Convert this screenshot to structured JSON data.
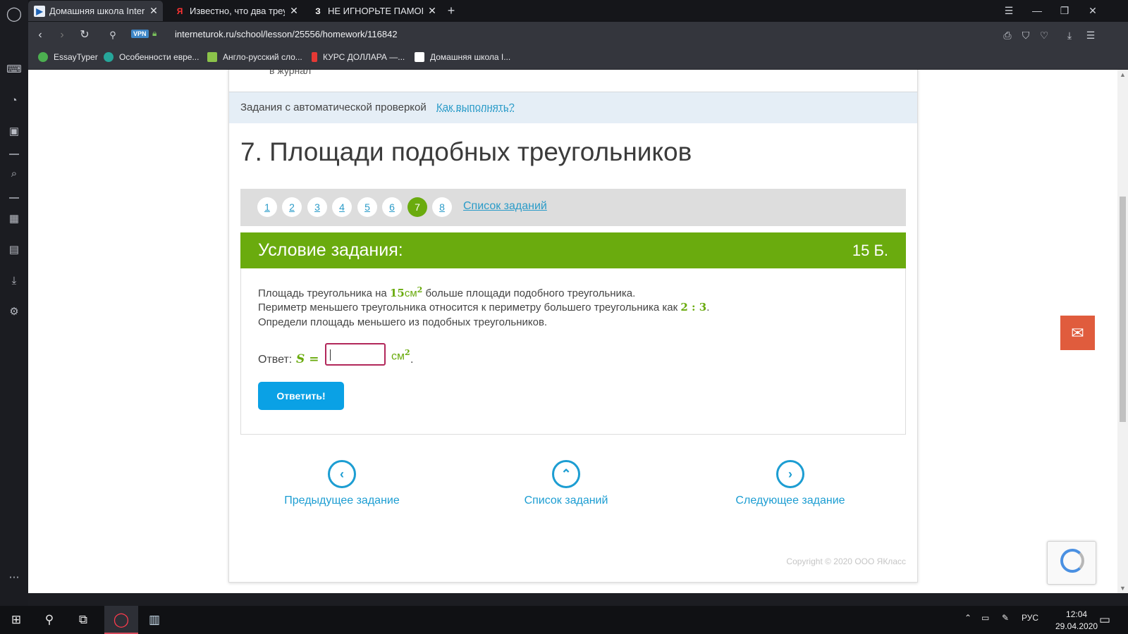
{
  "browser": {
    "tabs": [
      {
        "label": "Домашняя школа Internet",
        "icon": "interneturok-favicon",
        "active": true
      },
      {
        "label": "Известно, что два треугол",
        "icon": "yandex-favicon",
        "active": false
      },
      {
        "label": "НЕ ИГНОРЬТЕ ПАМОГИТЕ",
        "icon": "znanija-favicon",
        "active": false
      }
    ],
    "tab_icon_glyphs": {
      "yandex": "Я",
      "znanija": "З"
    },
    "new_tab_symbol": "+",
    "url": "interneturok.ru/school/lesson/25556/homework/116842",
    "vpn_label": "VPN",
    "bookmarks": [
      {
        "label": "EssayTyper",
        "color": "#4caf50"
      },
      {
        "label": "Особенности евре...",
        "color": "#26a69a"
      },
      {
        "label": "Англо-русский сло...",
        "color": "#8bc34a"
      },
      {
        "label": "КУРС ДОЛЛАРА —...",
        "color": "#e53935"
      },
      {
        "label": "Домашняя школа I...",
        "color": "#ffffff"
      }
    ]
  },
  "page": {
    "journal_text": "в журнал",
    "auto_check_text": "Задания с автоматической проверкой",
    "how_to_link": "Как выполнять?",
    "lesson_title": "7. Площади подобных треугольников",
    "pager": {
      "items": [
        "1",
        "2",
        "3",
        "4",
        "5",
        "6",
        "7",
        "8"
      ],
      "current": "7",
      "list_link": "Список заданий"
    },
    "task": {
      "title": "Условие задания:",
      "points": "15 Б.",
      "line1_prefix": "Площадь треугольника на",
      "line1_value": "15",
      "line1_unit": "см",
      "line1_power": "2",
      "line1_suffix": "больше площади подобного треугольника.",
      "line2_prefix": "Периметр меньшего треугольника относится к периметру большего треугольника как",
      "line2_ratio": "2 : 3",
      "line2_suffix": ".",
      "line3": "Определи площадь меньшего из подобных треугольников.",
      "answer_label": "Ответ:",
      "answer_var": "S =",
      "answer_value": "",
      "answer_unit": "см",
      "answer_power": "2",
      "answer_dot": ".",
      "submit_label": "Ответить!"
    },
    "bottom_nav": [
      {
        "label": "Предыдущее задание",
        "icon": "chevron-left-icon",
        "glyph": "‹"
      },
      {
        "label": "Список заданий",
        "icon": "chevron-up-icon",
        "glyph": "⌃"
      },
      {
        "label": "Следующее задание",
        "icon": "chevron-right-icon",
        "glyph": "›"
      }
    ],
    "copyright": "Copyright © 2020 ООО ЯКласс",
    "colors": {
      "accent_green": "#6aab0e",
      "link_blue": "#2a9bc8",
      "button_blue": "#0aa1e5",
      "chat_orange": "#e05c3d"
    }
  },
  "taskbar": {
    "language": "РУС",
    "time": "12:04",
    "date": "29.04.2020"
  }
}
